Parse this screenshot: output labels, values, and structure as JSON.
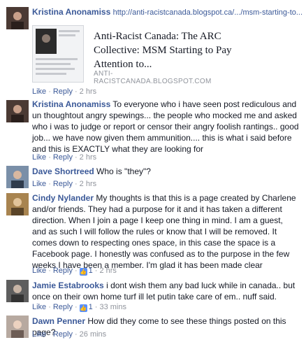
{
  "comments": [
    {
      "author": "Kristina Anonamiss",
      "link_text": "http://anti-racistcanada.blogspot.ca/.../msm-starting-to...",
      "preview": {
        "title": "Anti-Racist Canada: The ARC Collective: MSM Starting to Pay Attention to...",
        "domain": "ANTI-RACISTCANADA.BLOGSPOT.COM"
      },
      "like_label": "Like",
      "reply_label": "Reply",
      "time": "2 hrs"
    },
    {
      "author": "Kristina Anonamiss",
      "text": "To everyone who i have seen post rediculous and un thoughtout angry spewings... the people who mocked me and asked who i was to judge or report or censor their angry foolish rantings.. good job... we have now given them ammunition.... this is what i said before and this is EXACTLY what they are looking for",
      "like_label": "Like",
      "reply_label": "Reply",
      "time": "2 hrs"
    },
    {
      "author": "Dave Shortreed",
      "text": "Who is \"they\"?",
      "like_label": "Like",
      "reply_label": "Reply",
      "time": "2 hrs"
    },
    {
      "author": "Cindy Nylander",
      "text": "My thoughts is that this is a page created by Charlene and/or friends. They had a purpose for it and it has taken a different direction. When I join a page I keep one thing in mind. I am a guest, and as such I will follow the rules or know that I will be removed. It comes down to respecting ones space, in this case the space is a Facebook page. I honestly was confused as to the purpose in the few weeks I have been a member. I'm glad it has been made clear",
      "like_label": "Like",
      "reply_label": "Reply",
      "like_count": "1",
      "time": "2 hrs"
    },
    {
      "author": "Jamie Estabrooks",
      "text": "i dont wish them any bad luck while in canada.. but once on their own home turf ill let putin take care of em.. nuff said.",
      "like_label": "Like",
      "reply_label": "Reply",
      "like_count": "1",
      "time": "33 mins"
    },
    {
      "author": "Dawn Penner",
      "text": "How did they come to see these things posted on this page?",
      "like_label": "Like",
      "reply_label": "Reply",
      "time": "26 mins"
    }
  ],
  "colors": {
    "link": "#3b5998",
    "meta": "#90949c",
    "like_badge": "#5890ff"
  },
  "icons": {
    "like_badge": "thumbs-up-icon"
  }
}
